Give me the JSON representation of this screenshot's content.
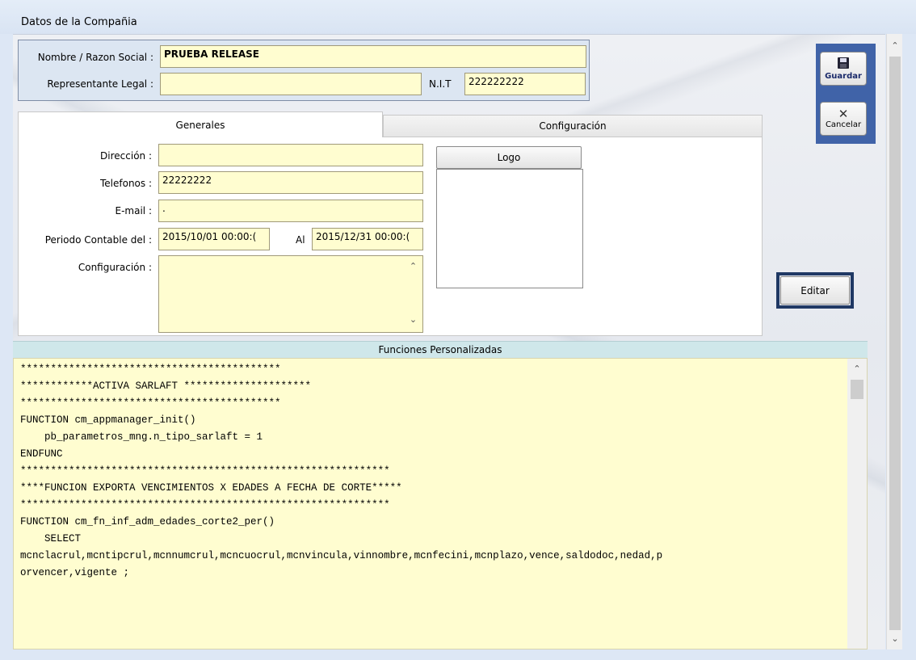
{
  "window": {
    "title": "Datos de la Compañia"
  },
  "company": {
    "name_label": "Nombre / Razon Social :",
    "name_value": "PRUEBA RELEASE",
    "rep_label": "Representante Legal :",
    "rep_value": "",
    "nit_label": "N.I.T",
    "nit_value": "222222222"
  },
  "toolbar": {
    "save_label": "Guardar",
    "cancel_label": "Cancelar"
  },
  "tabs": [
    {
      "label": "Generales",
      "active": true
    },
    {
      "label": "Configuración",
      "active": false
    }
  ],
  "generales": {
    "direccion_label": "Dirección :",
    "direccion_value": "",
    "telefonos_label": "Telefonos :",
    "telefonos_value": "22222222",
    "email_label": "E-mail :",
    "email_value": ".",
    "periodo_label": "Periodo Contable del :",
    "periodo_from": "2015/10/01 00:00:(",
    "periodo_al_label": "Al",
    "periodo_to": "2015/12/31 00:00:(",
    "config_label": "Configuración :",
    "config_value": "",
    "logo_label": "Logo",
    "edit_label": "Editar"
  },
  "funciones": {
    "header": "Funciones Personalizadas",
    "lines": [
      "*******************************************",
      "************ACTIVA SARLAFT *********************",
      "*******************************************",
      "FUNCTION cm_appmanager_init()",
      "    pb_parametros_mng.n_tipo_sarlaft = 1",
      "",
      "ENDFUNC",
      "",
      "",
      "*************************************************************",
      "****FUNCION EXPORTA VENCIMIENTOS X EDADES A FECHA DE CORTE*****",
      "*************************************************************",
      "",
      "FUNCTION cm_fn_inf_adm_edades_corte2_per()",
      "",
      "    SELECT",
      "mcnclacrul,mcntipcrul,mcnnumcrul,mcncuocrul,mcnvincula,vinnombre,mcnfecini,mcnplazo,vence,saldodoc,nedad,p",
      "orvencer,vigente ;"
    ]
  }
}
